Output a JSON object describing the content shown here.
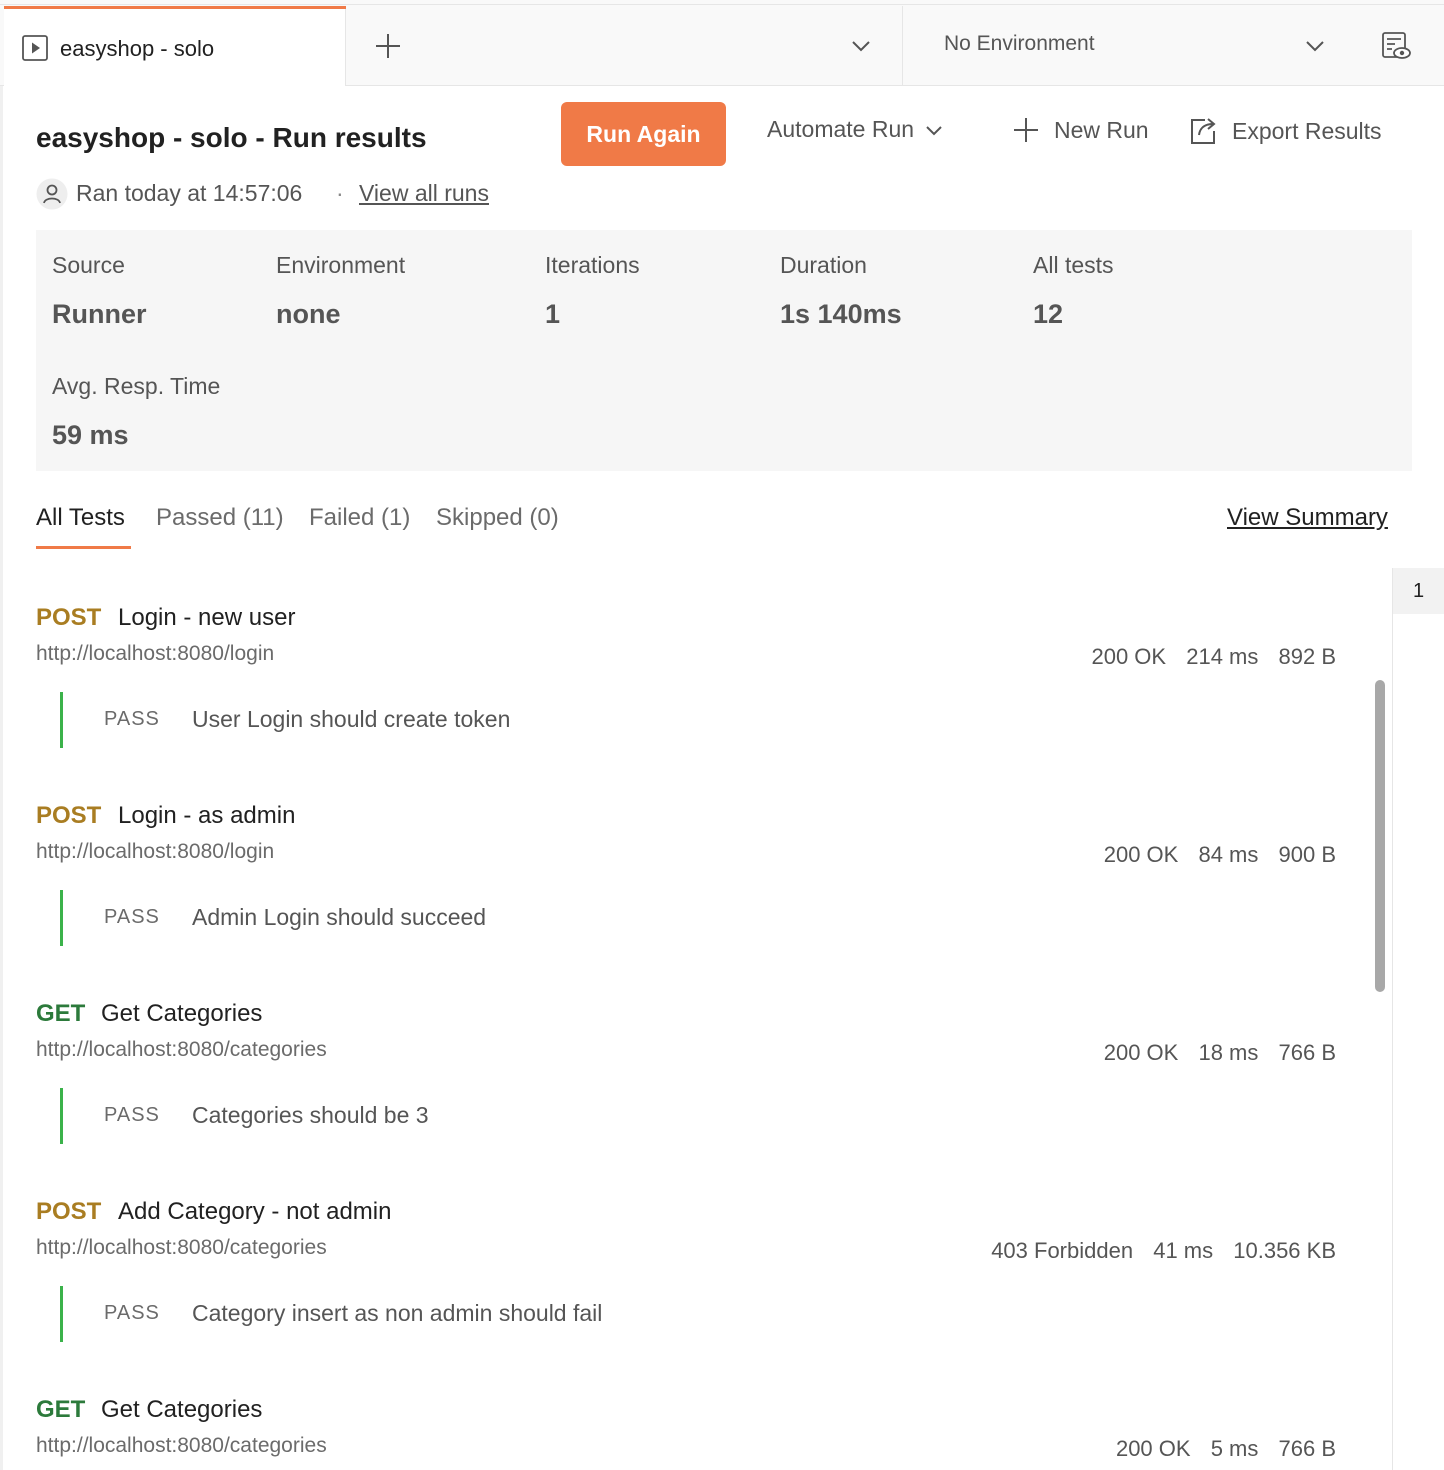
{
  "tabbar": {
    "active_tab_title": "easyshop - solo",
    "environment": "No Environment"
  },
  "header": {
    "title": "easyshop - solo - Run results",
    "run_again": "Run Again",
    "automate_run": "Automate Run",
    "new_run": "New Run",
    "export_results": "Export Results",
    "ran_at": "Ran today at 14:57:06",
    "separator": "·",
    "view_all_runs": "View all runs"
  },
  "stats": [
    {
      "label": "Source",
      "value": "Runner"
    },
    {
      "label": "Environment",
      "value": "none"
    },
    {
      "label": "Iterations",
      "value": "1"
    },
    {
      "label": "Duration",
      "value": "1s 140ms"
    },
    {
      "label": "All tests",
      "value": "12"
    },
    {
      "label": "Avg. Resp. Time",
      "value": "59 ms"
    }
  ],
  "filters": {
    "all": "All Tests",
    "passed": "Passed (11)",
    "failed": "Failed (1)",
    "skipped": "Skipped (0)",
    "view_summary": "View Summary"
  },
  "requests": [
    {
      "method": "POST",
      "name": "Login - new user",
      "url": "http://localhost:8080/login",
      "status": "200 OK",
      "time": "214 ms",
      "size": "892 B",
      "result": "PASS",
      "test": "User Login should create token"
    },
    {
      "method": "POST",
      "name": "Login - as admin",
      "url": "http://localhost:8080/login",
      "status": "200 OK",
      "time": "84 ms",
      "size": "900 B",
      "result": "PASS",
      "test": "Admin Login should succeed"
    },
    {
      "method": "GET",
      "name": "Get Categories",
      "url": "http://localhost:8080/categories",
      "status": "200 OK",
      "time": "18 ms",
      "size": "766 B",
      "result": "PASS",
      "test": "Categories should be 3"
    },
    {
      "method": "POST",
      "name": "Add Category - not admin",
      "url": "http://localhost:8080/categories",
      "status": "403 Forbidden",
      "time": "41 ms",
      "size": "10.356 KB",
      "result": "PASS",
      "test": "Category insert as non admin should fail"
    },
    {
      "method": "GET",
      "name": "Get Categories",
      "url": "http://localhost:8080/categories",
      "status": "200 OK",
      "time": "5 ms",
      "size": "766 B"
    }
  ],
  "iterations": [
    "1"
  ],
  "colors": {
    "accent": "#f07a47",
    "post": "#a97d22",
    "get": "#2c7a3b",
    "pass_bar": "#3bb24a"
  }
}
